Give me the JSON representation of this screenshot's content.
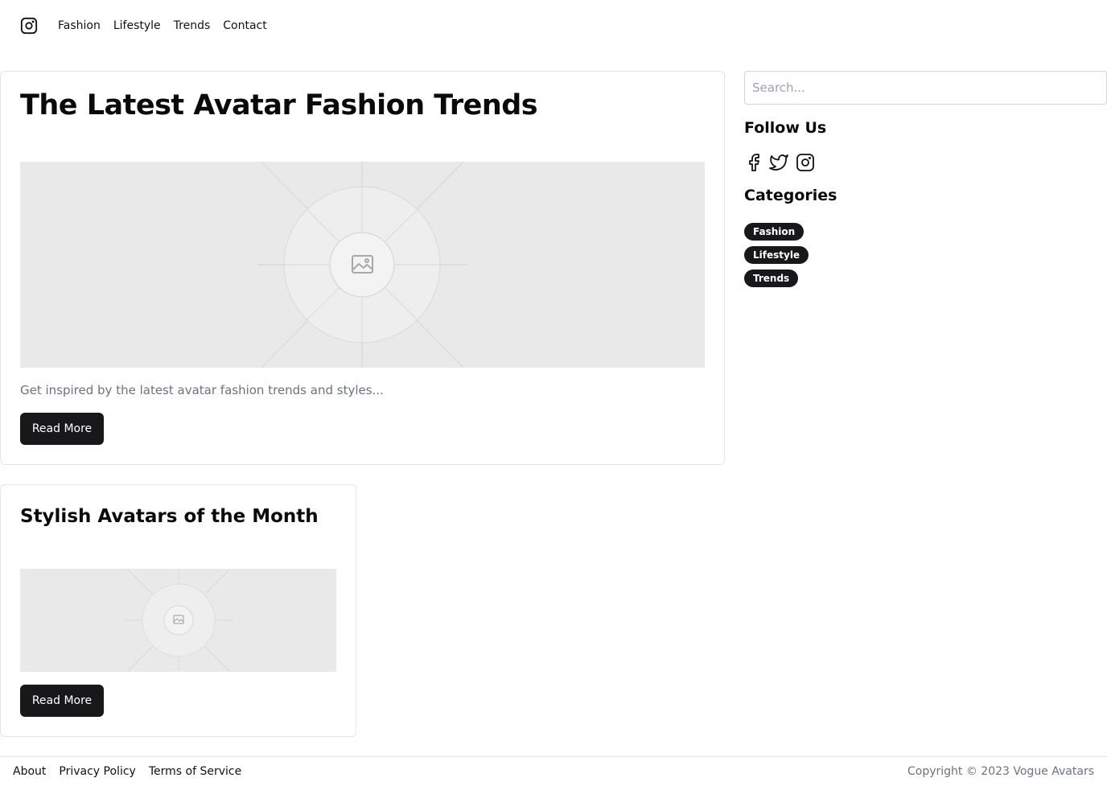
{
  "header": {
    "logo_icon": "instagram-icon",
    "nav": [
      {
        "label": "Fashion"
      },
      {
        "label": "Lifestyle"
      },
      {
        "label": "Trends"
      },
      {
        "label": "Contact"
      }
    ]
  },
  "posts": [
    {
      "title": "The Latest Avatar Fashion Trends",
      "excerpt": "Get inspired by the latest avatar fashion trends and styles...",
      "button_label": "Read More",
      "image_icon": "image-placeholder-icon"
    },
    {
      "title": "Stylish Avatars of the Month",
      "button_label": "Read More",
      "image_icon": "image-placeholder-icon"
    }
  ],
  "sidebar": {
    "search_placeholder": "Search...",
    "follow_heading": "Follow Us",
    "social_icons": [
      "facebook-icon",
      "twitter-icon",
      "instagram-icon"
    ],
    "categories_heading": "Categories",
    "categories": [
      {
        "label": "Fashion"
      },
      {
        "label": "Lifestyle"
      },
      {
        "label": "Trends"
      }
    ]
  },
  "footer": {
    "links": [
      {
        "label": "About"
      },
      {
        "label": "Privacy Policy"
      },
      {
        "label": "Terms of Service"
      }
    ],
    "copyright": "Copyright © 2023 Vogue Avatars"
  },
  "colors": {
    "button_bg": "#18181b",
    "placeholder_bg": "#e9e9e9",
    "muted_text": "#6b7280",
    "border": "#e5e5e5"
  }
}
